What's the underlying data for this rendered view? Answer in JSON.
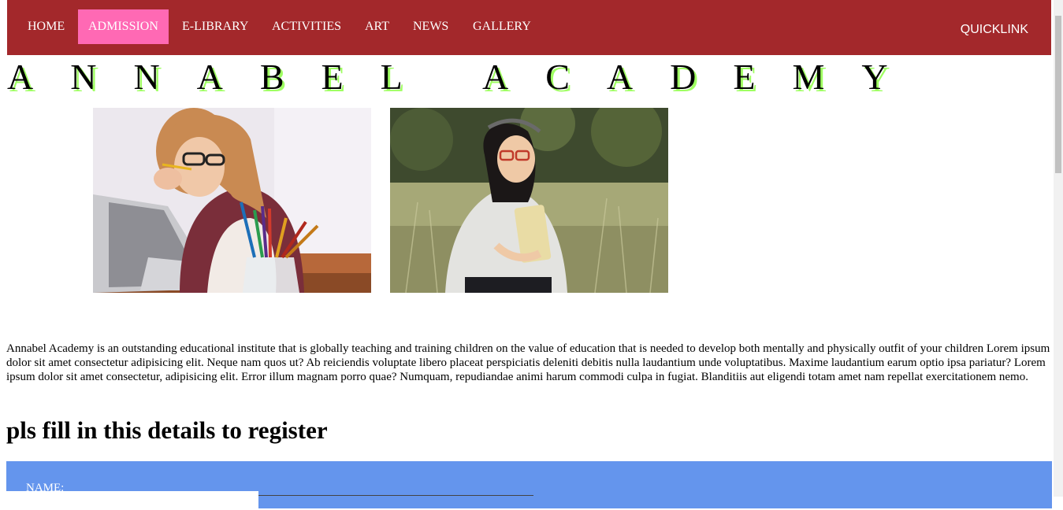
{
  "nav": {
    "items": [
      {
        "label": "HOME"
      },
      {
        "label": "ADMISSION"
      },
      {
        "label": "E-LIBRARY"
      },
      {
        "label": "ACTIVITIES"
      },
      {
        "label": "ART"
      },
      {
        "label": "NEWS"
      },
      {
        "label": "GALLERY"
      }
    ],
    "quicklink": "QUICKLINK",
    "active": "ADMISSION",
    "bar_color": "#a3282b",
    "active_color": "#ff69b4"
  },
  "header": {
    "title": "ANNABEL ACADEMY"
  },
  "photos": [
    {
      "subject": "woman-with-laptop-and-pencils-photo"
    },
    {
      "subject": "girl-holding-book-in-field-photo"
    }
  ],
  "intro": {
    "text": "Annabel Academy is an outstanding educational institute that is globally teaching and training children on the value of education that is needed to develop both mentally and physically outfit of your children Lorem ipsum dolor sit amet consectetur adipisicing elit. Neque nam quos ut? Ab reiciendis voluptate libero placeat perspiciatis deleniti debitis nulla laudantium unde voluptatibus. Maxime laudantium earum optio ipsa pariatur? Lorem ipsum dolor sit amet consectetur, adipisicing elit. Error illum magnam porro quae? Numquam, repudiandae animi harum commodi culpa in fugiat. Blanditiis aut eligendi totam amet nam repellat exercitationem nemo."
  },
  "form": {
    "heading": "pls fill in this details to register",
    "name_label": "NAME:",
    "name_value": "",
    "panel_color": "#6495ed"
  }
}
